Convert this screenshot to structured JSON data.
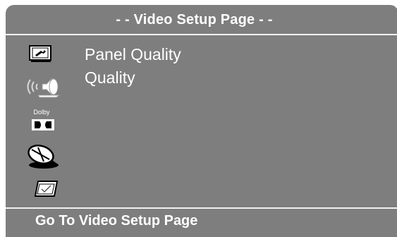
{
  "header": {
    "title": "- - Video Setup Page - -"
  },
  "sidebar": {
    "icons": [
      {
        "name": "general-setup-icon"
      },
      {
        "name": "speaker-setup-icon"
      },
      {
        "name": "dolby-digital-icon",
        "label": "Dolby"
      },
      {
        "name": "video-setup-icon"
      },
      {
        "name": "preference-icon"
      }
    ]
  },
  "menu": {
    "items": [
      {
        "label": "Panel Quality"
      },
      {
        "label": "Quality"
      }
    ]
  },
  "status": {
    "text": "Go To Video Setup Page"
  },
  "colors": {
    "background": "#7e7e7e",
    "text": "#ffffff"
  }
}
